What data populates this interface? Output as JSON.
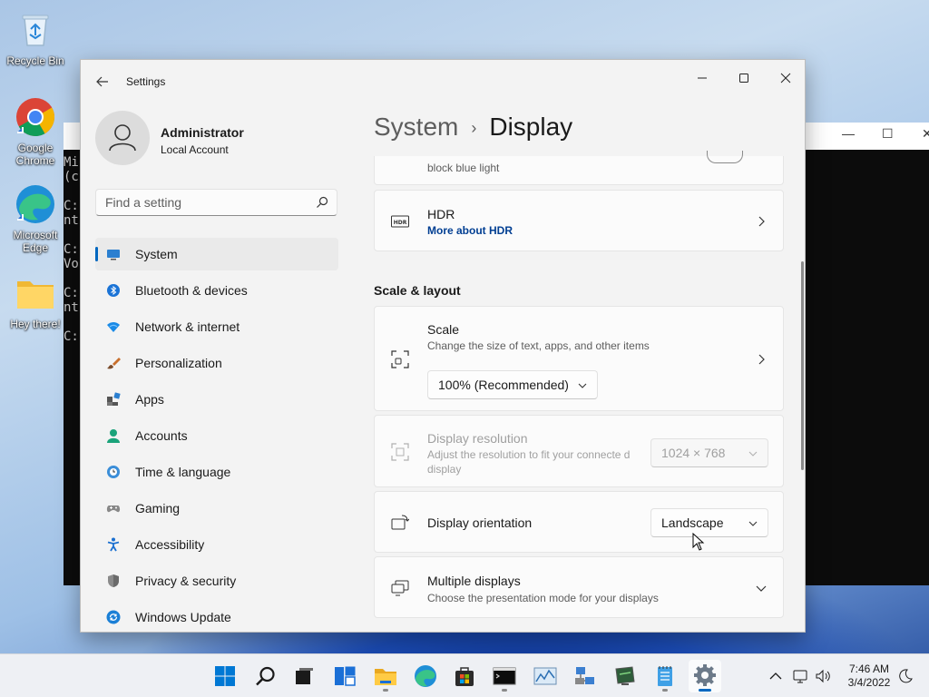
{
  "desktop": {
    "icons": [
      {
        "label": "Recycle Bin"
      },
      {
        "label": "Google Chrome"
      },
      {
        "label": "Microsoft Edge"
      },
      {
        "label": "Hey there!"
      }
    ]
  },
  "console": {
    "lines": [
      "Mi",
      "(c",
      "",
      "C:",
      "nt",
      "",
      "C:",
      "Vo",
      "",
      "C:",
      "nt",
      "",
      "C:"
    ]
  },
  "window": {
    "title": "Settings",
    "minimize_glyph": "—",
    "maximize_glyph": "☐",
    "close_glyph": "✕"
  },
  "profile": {
    "name": "Administrator",
    "account_type": "Local Account"
  },
  "search": {
    "placeholder": "Find a setting"
  },
  "nav": {
    "items": [
      {
        "label": "System",
        "icon": "monitor-icon",
        "active": true
      },
      {
        "label": "Bluetooth & devices",
        "icon": "bluetooth-icon"
      },
      {
        "label": "Network & internet",
        "icon": "wifi-icon"
      },
      {
        "label": "Personalization",
        "icon": "brush-icon"
      },
      {
        "label": "Apps",
        "icon": "apps-icon"
      },
      {
        "label": "Accounts",
        "icon": "person-icon"
      },
      {
        "label": "Time & language",
        "icon": "globe-clock-icon"
      },
      {
        "label": "Gaming",
        "icon": "gamepad-icon"
      },
      {
        "label": "Accessibility",
        "icon": "accessibility-icon"
      },
      {
        "label": "Privacy & security",
        "icon": "shield-icon"
      },
      {
        "label": "Windows Update",
        "icon": "update-icon"
      }
    ]
  },
  "breadcrumb": {
    "parent": "System",
    "separator": "›",
    "current": "Display"
  },
  "content": {
    "night_light_sub": "block blue light",
    "hdr": {
      "title": "HDR",
      "link": "More about HDR"
    },
    "section_title": "Scale & layout",
    "scale": {
      "title": "Scale",
      "subtitle": "Change the size of text, apps, and other items",
      "value": "100% (Recommended)"
    },
    "resolution": {
      "title": "Display resolution",
      "subtitle": "Adjust the resolution to fit your connecte d display",
      "value": "1024 × 768"
    },
    "orientation": {
      "title": "Display orientation",
      "value": "Landscape"
    },
    "multiple": {
      "title": "Multiple displays",
      "subtitle": "Choose the presentation mode for your displays"
    }
  },
  "taskbar": {
    "apps": [
      "start-icon",
      "search-icon",
      "task-view-icon",
      "widgets-icon",
      "file-explorer-icon",
      "edge-icon",
      "store-icon",
      "terminal-icon",
      "performance-monitor-icon",
      "network-app-icon",
      "remote-desktop-icon",
      "notepad-icon",
      "settings-icon"
    ],
    "time": "7:46 AM",
    "date": "3/4/2022"
  },
  "colors": {
    "accent": "#0067c0",
    "link": "#003e92"
  }
}
